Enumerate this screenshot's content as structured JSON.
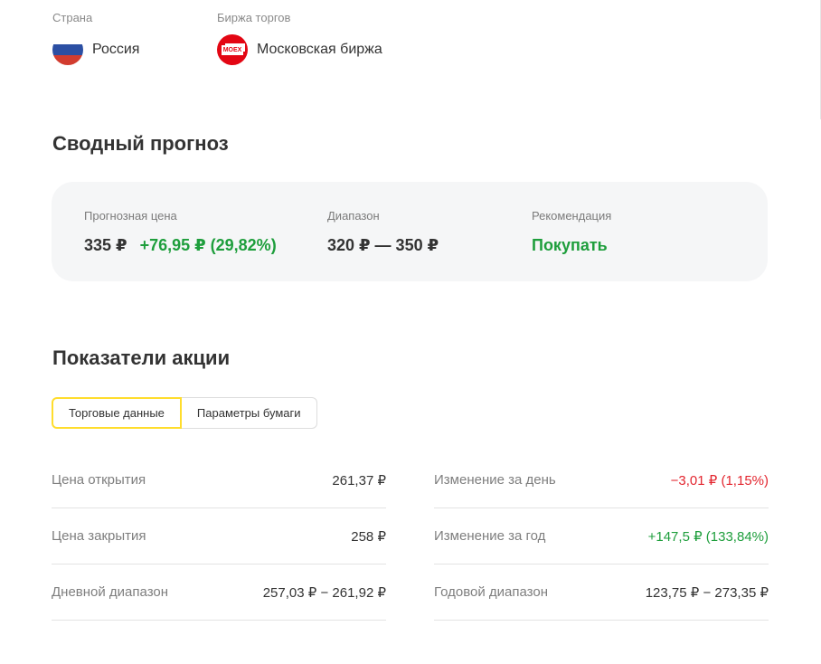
{
  "meta": {
    "country_label": "Страна",
    "country_value": "Россия",
    "country_icon": "russia-flag-icon",
    "exchange_label": "Биржа торгов",
    "exchange_value": "Московская биржа",
    "exchange_icon": "moex-logo-icon",
    "exchange_logo_text": "MOEX"
  },
  "forecast": {
    "title": "Сводный прогноз",
    "price_label": "Прогнозная цена",
    "price_value": "335 ₽",
    "price_change": "+76,95 ₽ (29,82%)",
    "range_label": "Диапазон",
    "range_value": "320 ₽ — 350 ₽",
    "recommendation_label": "Рекомендация",
    "recommendation_value": "Покупать"
  },
  "indicators": {
    "title": "Показатели акции",
    "tabs": [
      {
        "label": "Торговые данные",
        "active": true
      },
      {
        "label": "Параметры бумаги",
        "active": false
      }
    ],
    "left_rows": [
      {
        "label": "Цена открытия",
        "value": "261,37 ₽"
      },
      {
        "label": "Цена закрытия",
        "value": "258 ₽"
      },
      {
        "label": "Дневной диапазон",
        "value": "257,03 ₽ − 261,92 ₽"
      }
    ],
    "right_rows": [
      {
        "label": "Изменение за день",
        "value": "−3,01 ₽ (1,15%)"
      },
      {
        "label": "Изменение за год",
        "value": "+147,5 ₽ (133,84%)"
      },
      {
        "label": "Годовой диапазон",
        "value": "123,75 ₽ − 273,35 ₽"
      }
    ]
  },
  "colors": {
    "accent_yellow": "#ffdd2d",
    "positive_green": "#1e9e3c",
    "negative_red": "#e3262f",
    "card_background": "#f5f6f7",
    "moex_red": "#e30613"
  }
}
